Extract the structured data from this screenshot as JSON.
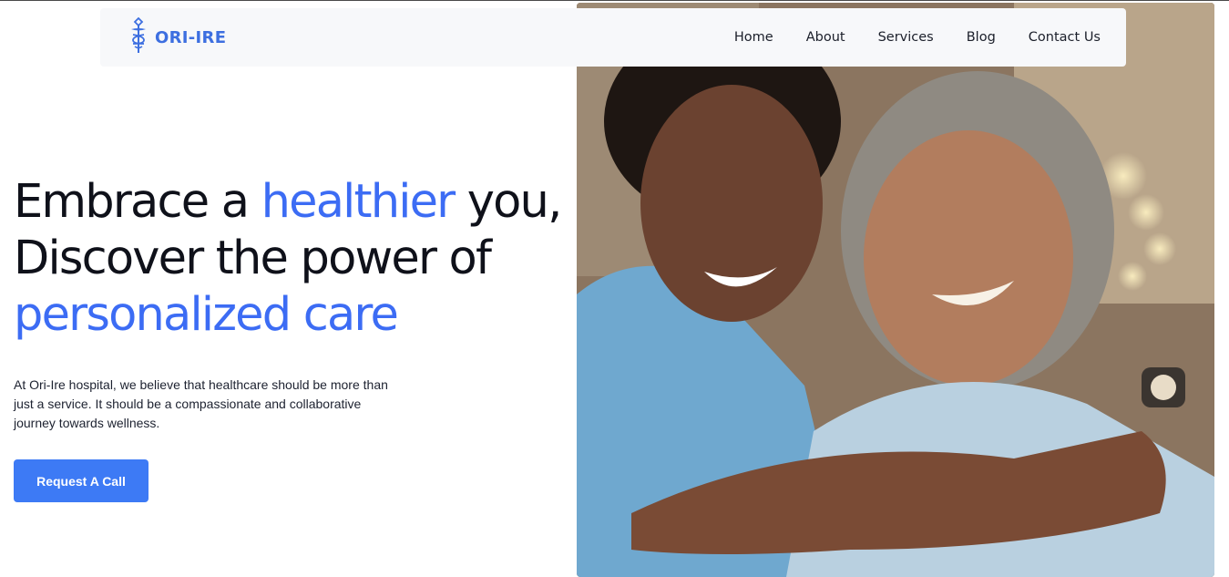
{
  "brand": {
    "name": "ORI-IRE",
    "logo_icon": "caduceus-icon"
  },
  "nav": {
    "items": [
      {
        "label": "Home"
      },
      {
        "label": "About"
      },
      {
        "label": "Services"
      },
      {
        "label": "Blog"
      },
      {
        "label": "Contact Us"
      }
    ]
  },
  "hero": {
    "line1_a": "Embrace a ",
    "line1_accent": "healthier",
    "line1_b": " you,",
    "line2": "Discover the power of",
    "line3_accent": "personalized care",
    "description": "At Ori-Ire hospital, we believe that healthcare should be more than just a service. It should be a compassionate and collaborative journey towards wellness.",
    "cta_label": "Request A Call",
    "image_alt": "nurse-hugging-senior-patient-photo"
  },
  "colors": {
    "accent": "#3c6cf4",
    "button": "#3d7af5",
    "nav_bg": "#f7f8fa",
    "text": "#0f111a"
  }
}
